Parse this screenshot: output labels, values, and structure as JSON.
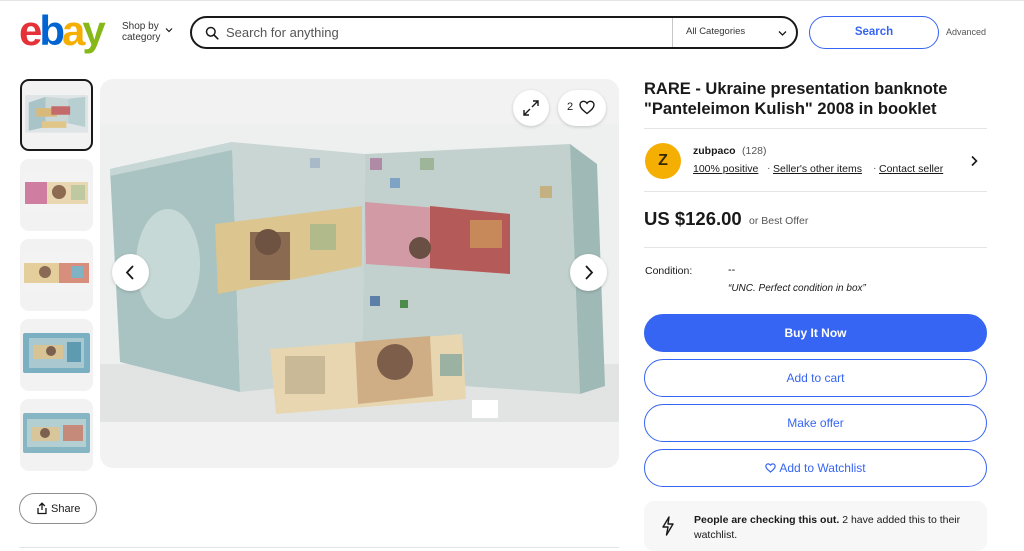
{
  "header": {
    "logo_letters": [
      "e",
      "b",
      "a",
      "y"
    ],
    "shop_by_label_line1": "Shop by",
    "shop_by_label_line2": "category",
    "search_placeholder": "Search for anything",
    "category_select": "All Categories",
    "search_button": "Search",
    "advanced_link": "Advanced"
  },
  "gallery": {
    "thumbnails": [
      {
        "selected": true
      },
      {
        "selected": false
      },
      {
        "selected": false
      },
      {
        "selected": false
      },
      {
        "selected": false
      }
    ],
    "watch_count": "2",
    "share_label": "Share"
  },
  "listing": {
    "title": "RARE - Ukraine presentation banknote \"Panteleimon Kulish\" 2008 in booklet",
    "seller": {
      "avatar_letter": "Z",
      "name": "zubpaco",
      "feedback_count": "(128)",
      "positive": "100% positive",
      "other_items": "Seller's other items",
      "contact": "Contact seller"
    },
    "price": "US $126.00",
    "best_offer": "or Best Offer",
    "condition_label": "Condition:",
    "condition_value": "--",
    "condition_note": "“UNC. Perfect condition in box”",
    "buttons": {
      "buy_now": "Buy It Now",
      "add_to_cart": "Add to cart",
      "make_offer": "Make offer",
      "add_to_watchlist": "Add to Watchlist"
    },
    "notice": {
      "bold": "People are checking this out.",
      "rest": " 2 have added this to their watchlist."
    }
  },
  "colors": {
    "accent": "#3665f3",
    "logo_red": "#e53238",
    "logo_blue": "#0064d2",
    "logo_yellow": "#f5af02",
    "logo_green": "#86b817"
  }
}
